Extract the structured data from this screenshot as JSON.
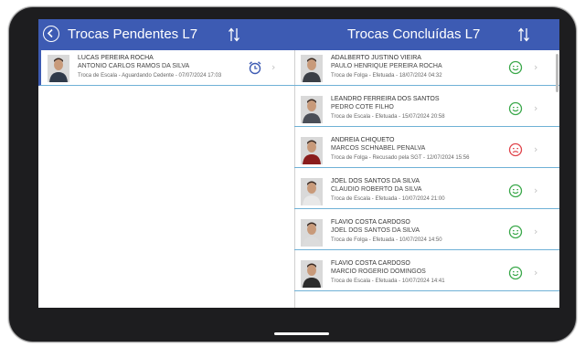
{
  "left_panel": {
    "title": "Trocas Pendentes L7",
    "items": [
      {
        "name": "LUCAS PEREIRA ROCHA",
        "partner": "ANTONIO CARLOS RAMOS DA SILVA",
        "detail": "Troca de Escala - Aguardando Cedente - 07/07/2024 17:03",
        "status_icon": "alarm-clock-icon"
      }
    ]
  },
  "right_panel": {
    "title": "Trocas Concluídas L7",
    "items": [
      {
        "name": "ADALBERTO JUSTINO VIEIRA",
        "partner": "PAULO HENRIQUE PEREIRA ROCHA",
        "detail": "Troca de Folga - Efetuada - 18/07/2024 04:32",
        "status_icon": "happy-face-icon"
      },
      {
        "name": "LEANDRO FERREIRA DOS SANTOS",
        "partner": "PEDRO COTE FILHO",
        "detail": "Troca de Escala - Efetuada - 15/07/2024 20:58",
        "status_icon": "happy-face-icon"
      },
      {
        "name": "ANDREIA CHIQUETO",
        "partner": "MARCOS SCHNABEL PENALVA",
        "detail": "Troca de Folga - Recusado pela SGT - 12/07/2024 15:56",
        "status_icon": "sad-face-icon"
      },
      {
        "name": "JOEL DOS SANTOS DA SILVA",
        "partner": "CLAUDIO ROBERTO DA SILVA",
        "detail": "Troca de Escala - Efetuada - 10/07/2024 21:00",
        "status_icon": "happy-face-icon"
      },
      {
        "name": "FLAVIO COSTA CARDOSO",
        "partner": "JOEL DOS SANTOS DA SILVA",
        "detail": "Troca de Folga - Efetuada - 10/07/2024 14:50",
        "status_icon": "happy-face-icon"
      },
      {
        "name": "FLAVIO COSTA CARDOSO",
        "partner": "MARCIO ROGERIO DOMINGOS",
        "detail": "Troca de Escala - Efetuada - 10/07/2024 14:41",
        "status_icon": "happy-face-icon"
      }
    ]
  },
  "colors": {
    "header": "#3d5bb3",
    "row_divider": "#6fb1d6",
    "status_ok": "#3aa84a",
    "status_refused": "#e0444b",
    "pending_icon": "#3d5bb3"
  },
  "icons": {
    "back": "back-circle-arrow-icon",
    "sort": "sort-arrows-icon",
    "chevron": "chevron-right-icon",
    "avatar": "person-photo-icon"
  }
}
